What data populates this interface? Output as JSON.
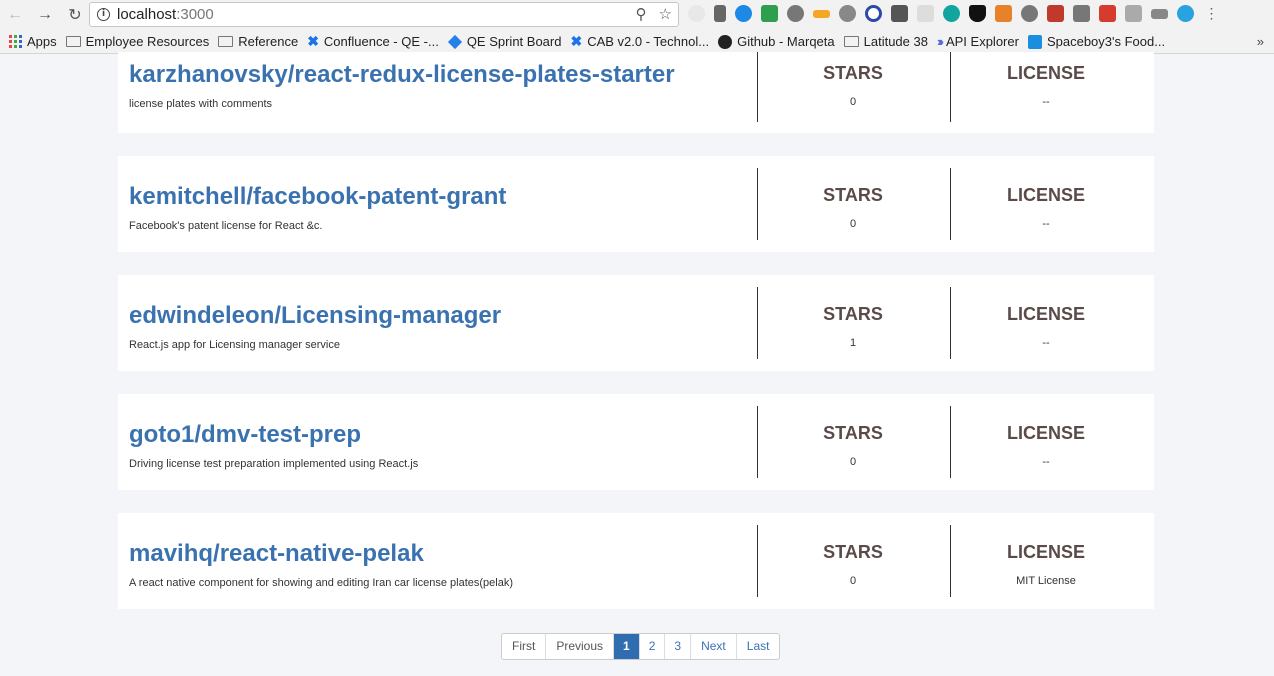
{
  "browser": {
    "url_host": "localhost",
    "url_port": ":3000"
  },
  "bookmarks": [
    {
      "label": "Apps"
    },
    {
      "label": "Employee Resources"
    },
    {
      "label": "Reference"
    },
    {
      "label": "Confluence - QE -..."
    },
    {
      "label": "QE Sprint Board"
    },
    {
      "label": "CAB v2.0 - Technol..."
    },
    {
      "label": "Github - Marqeta"
    },
    {
      "label": "Latitude 38"
    },
    {
      "label": "API Explorer"
    },
    {
      "label": "Spaceboy3's Food..."
    }
  ],
  "bookmarks_more": "»",
  "repos": [
    {
      "name": "karzhanovsky/react-redux-license-plates-starter",
      "description": "license plates with comments",
      "stars_label": "STARS",
      "stars": "0",
      "license_label": "LICENSE",
      "license": "--"
    },
    {
      "name": "kemitchell/facebook-patent-grant",
      "description": "Facebook's patent license for React &c.",
      "stars_label": "STARS",
      "stars": "0",
      "license_label": "LICENSE",
      "license": "--"
    },
    {
      "name": "edwindeleon/Licensing-manager",
      "description": "React.js app for Licensing manager service",
      "stars_label": "STARS",
      "stars": "1",
      "license_label": "LICENSE",
      "license": "--"
    },
    {
      "name": "goto1/dmv-test-prep",
      "description": "Driving license test preparation implemented using React.js",
      "stars_label": "STARS",
      "stars": "0",
      "license_label": "LICENSE",
      "license": "--"
    },
    {
      "name": "mavihq/react-native-pelak",
      "description": "A react native component for showing and editing Iran car license plates(pelak)",
      "stars_label": "STARS",
      "stars": "0",
      "license_label": "LICENSE",
      "license": "MIT License"
    }
  ],
  "pagination": {
    "first": "First",
    "previous": "Previous",
    "pages": [
      "1",
      "2",
      "3"
    ],
    "next": "Next",
    "last": "Last"
  }
}
